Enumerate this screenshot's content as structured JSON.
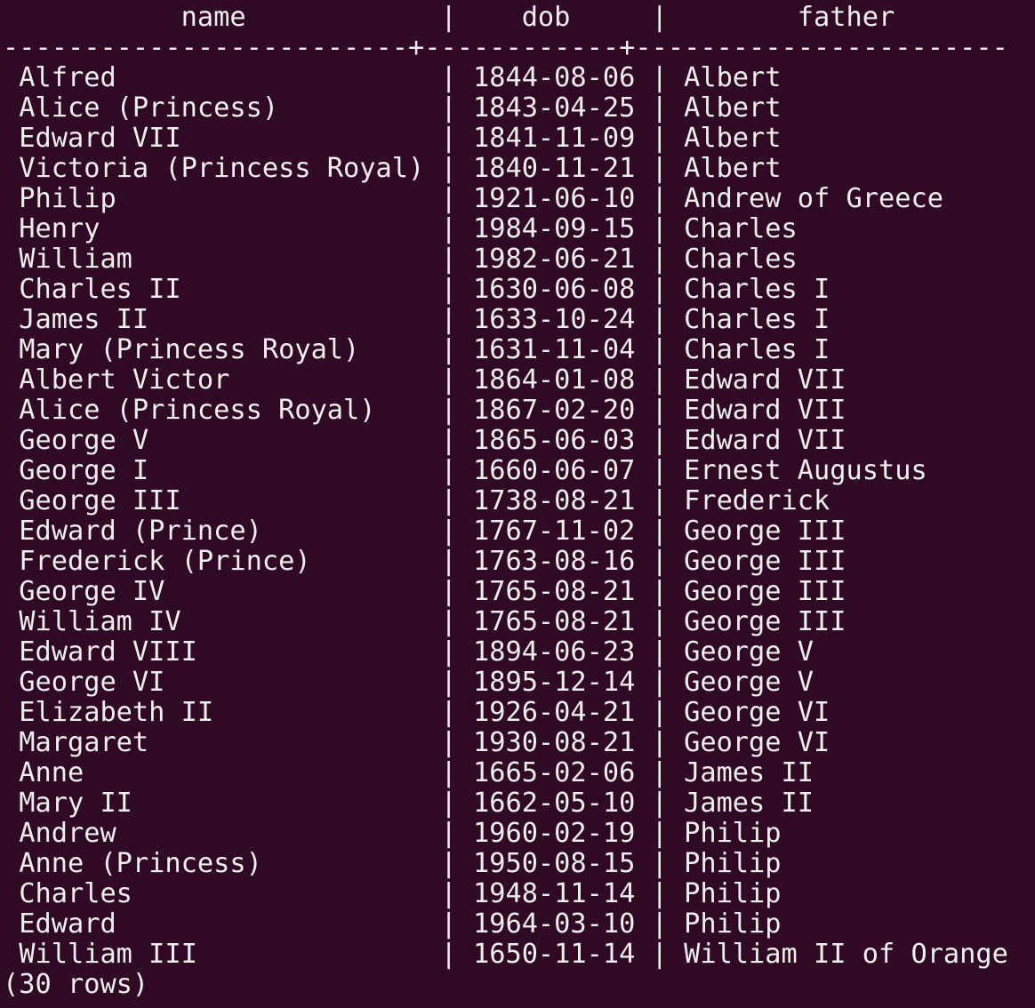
{
  "header": {
    "name": "name",
    "dob": "dob",
    "father": "father"
  },
  "separator": "-------------------------+------------+-----------------------",
  "rows": [
    {
      "name": "Alfred",
      "dob": "1844-08-06",
      "father": "Albert"
    },
    {
      "name": "Alice (Princess)",
      "dob": "1843-04-25",
      "father": "Albert"
    },
    {
      "name": "Edward VII",
      "dob": "1841-11-09",
      "father": "Albert"
    },
    {
      "name": "Victoria (Princess Royal)",
      "dob": "1840-11-21",
      "father": "Albert"
    },
    {
      "name": "Philip",
      "dob": "1921-06-10",
      "father": "Andrew of Greece"
    },
    {
      "name": "Henry",
      "dob": "1984-09-15",
      "father": "Charles"
    },
    {
      "name": "William",
      "dob": "1982-06-21",
      "father": "Charles"
    },
    {
      "name": "Charles II",
      "dob": "1630-06-08",
      "father": "Charles I"
    },
    {
      "name": "James II",
      "dob": "1633-10-24",
      "father": "Charles I"
    },
    {
      "name": "Mary (Princess Royal)",
      "dob": "1631-11-04",
      "father": "Charles I"
    },
    {
      "name": "Albert Victor",
      "dob": "1864-01-08",
      "father": "Edward VII"
    },
    {
      "name": "Alice (Princess Royal)",
      "dob": "1867-02-20",
      "father": "Edward VII"
    },
    {
      "name": "George V",
      "dob": "1865-06-03",
      "father": "Edward VII"
    },
    {
      "name": "George I",
      "dob": "1660-06-07",
      "father": "Ernest Augustus"
    },
    {
      "name": "George III",
      "dob": "1738-08-21",
      "father": "Frederick"
    },
    {
      "name": "Edward (Prince)",
      "dob": "1767-11-02",
      "father": "George III"
    },
    {
      "name": "Frederick (Prince)",
      "dob": "1763-08-16",
      "father": "George III"
    },
    {
      "name": "George IV",
      "dob": "1765-08-21",
      "father": "George III"
    },
    {
      "name": "William IV",
      "dob": "1765-08-21",
      "father": "George III"
    },
    {
      "name": "Edward VIII",
      "dob": "1894-06-23",
      "father": "George V"
    },
    {
      "name": "George VI",
      "dob": "1895-12-14",
      "father": "George V"
    },
    {
      "name": "Elizabeth II",
      "dob": "1926-04-21",
      "father": "George VI"
    },
    {
      "name": "Margaret",
      "dob": "1930-08-21",
      "father": "George VI"
    },
    {
      "name": "Anne",
      "dob": "1665-02-06",
      "father": "James II"
    },
    {
      "name": "Mary II",
      "dob": "1662-05-10",
      "father": "James II"
    },
    {
      "name": "Andrew",
      "dob": "1960-02-19",
      "father": "Philip"
    },
    {
      "name": "Anne (Princess)",
      "dob": "1950-08-15",
      "father": "Philip"
    },
    {
      "name": "Charles",
      "dob": "1948-11-14",
      "father": "Philip"
    },
    {
      "name": "Edward",
      "dob": "1964-03-10",
      "father": "Philip"
    },
    {
      "name": "William III",
      "dob": "1650-11-14",
      "father": "William II of Orange"
    }
  ],
  "footer": "(30 rows)",
  "colors": {
    "background": "#300a24",
    "foreground": "#eeeeec"
  }
}
